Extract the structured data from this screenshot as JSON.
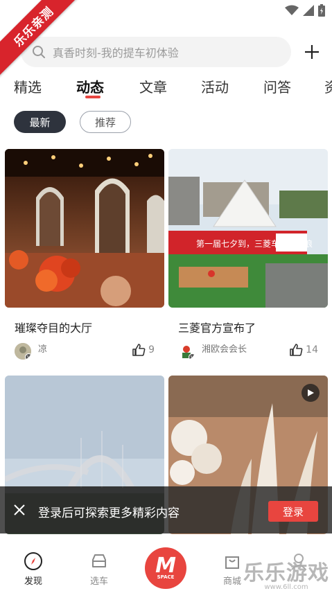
{
  "ribbon": {
    "text": "乐乐亲测"
  },
  "search": {
    "placeholder": "真香时刻-我的提车初体验"
  },
  "tabs": [
    {
      "label": "精选"
    },
    {
      "label": "动态"
    },
    {
      "label": "文章"
    },
    {
      "label": "活动"
    },
    {
      "label": "问答"
    },
    {
      "label": "资"
    }
  ],
  "filters": {
    "latest": "最新",
    "recommend": "推荐"
  },
  "cards": [
    {
      "title": "璀璨夺目的大厅",
      "author": "凉",
      "likes": "9"
    },
    {
      "title": "三菱官方宣布了",
      "author": "湘欧会会长",
      "likes": "14"
    },
    {
      "title": "",
      "author": "",
      "likes": ""
    },
    {
      "title": "",
      "author": "",
      "likes": ""
    }
  ],
  "photo_labels": {
    "banner_text": "第一届七夕到，三菱车友一起浪"
  },
  "banner": {
    "text": "登录后可探索更多精彩内容",
    "login": "登录"
  },
  "nav": {
    "discover": "发现",
    "select_car": "选车",
    "center_logo": "M",
    "center_sub": "SPACE",
    "mall": "商城"
  },
  "watermark": {
    "big": "乐乐游戏",
    "url": "www.6ll.com"
  },
  "colors": {
    "accent": "#e8453f",
    "pill_dark": "#2e333d"
  }
}
